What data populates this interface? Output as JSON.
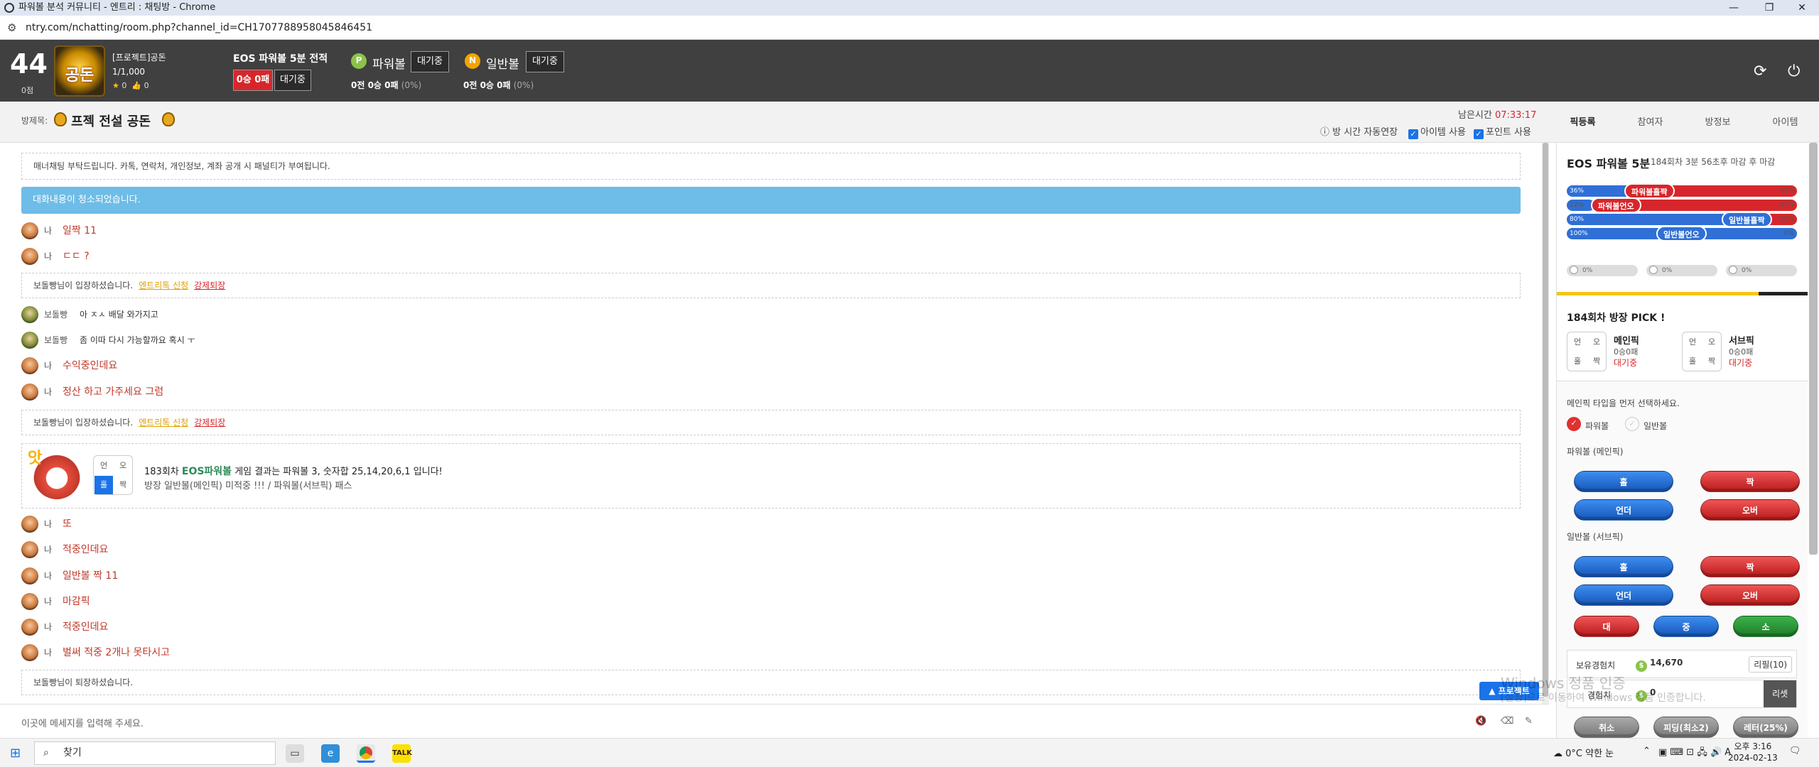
{
  "browser": {
    "title": "파워볼 분석 커뮤니티 - 엔트리 : 채팅방 - Chrome",
    "url": "ntry.com/nchatting/room.php?channel_id=CH1707788958045846451"
  },
  "header": {
    "level": "44",
    "level_sub": "0점",
    "avatar_text": "공돈",
    "username": "[프로젝트]공돈",
    "count": "1/1,000",
    "stars": "0",
    "likes": "0",
    "eos_title": "EOS 파워볼 5분 전적",
    "eos_record": "0승 0패",
    "eos_status": "대기중",
    "powerball_label": "파워볼",
    "powerball_status": "대기중",
    "powerball_record": "0전 0승 0패",
    "powerball_pct": "(0%)",
    "normalball_label": "일반볼",
    "normalball_status": "대기중",
    "normalball_record": "0전 0승 0패",
    "normalball_pct": "(0%)",
    "p_badge": "P",
    "n_badge": "N"
  },
  "room": {
    "label": "방제목:",
    "name": "프젝 전설 공돈",
    "remain_label": "남은시간",
    "remain_time": "07:33:17",
    "opt_extend": "방 시간 자동연장",
    "opt_item": "아이템 사용",
    "opt_point": "포인트 사용"
  },
  "tabs": [
    "픽등록",
    "참여자",
    "방정보",
    "아이템"
  ],
  "chat": {
    "notice": "매너채팅 부탁드립니다. 카톡, 연락처, 개인정보, 계좌 공개 시 패널티가 부여됩니다.",
    "cleared": "대화내용이 청소되었습니다.",
    "me": "나",
    "other": "보돌빵",
    "m1": "일짝 11",
    "m2": "ㄷㄷ ?",
    "join_text": "보돌빵님이 입장하셨습니다.",
    "entry_link": "엔트리톡 신청",
    "kick_link": "강제퇴장",
    "m3": "아 ㅈㅅ 배달 와가지고",
    "m4": "좀 이따 다시 가능할까요 혹시 ㅜ",
    "m5": "수익중인데요",
    "m6": "정산 하고 가주세요 그럼",
    "result_round": "183회차",
    "result_game": "EOS파워볼",
    "result_text": "게임 결과는 파워볼 3, 숫자합 25,14,20,6,1 입니다!",
    "result_host": "방장 일반볼(메인픽)",
    "result_miss": "미적중 !!! / 파워볼(서브픽) 패스",
    "grid": [
      "언",
      "오",
      "홀",
      "짝"
    ],
    "m7": "또",
    "m8": "적중인데요",
    "m9": "일반볼 짝 11",
    "m10": "마감픽",
    "m11": "적중인데요",
    "m12": "벌써 적중 2개나 못타시고",
    "leave_text": "보돌빵님이 퇴장하셨습니다.",
    "input_placeholder": "이곳에 메세지를 입력해 주세요.",
    "project_btn": "▲ 프로젝트"
  },
  "panel": {
    "game_title": "EOS 파워볼 5분",
    "game_sub": "184회차 3분 56초후 마감 후 마감",
    "bars": [
      {
        "label": "파워볼홀짝",
        "left": "36%",
        "right": "63%",
        "blue": 0.36,
        "red": 0.63
      },
      {
        "label": "파워볼언오",
        "left": "12%",
        "right": "87%",
        "blue": 0.12,
        "red": 0.87
      },
      {
        "label": "일반볼홀짝",
        "left": "80%",
        "right": "20%",
        "blue": 0.8,
        "red": 0.2
      },
      {
        "label": "일반볼언오",
        "left": "100%",
        "right": "0%",
        "blue": 1.0,
        "red": 0
      }
    ],
    "mini": [
      "0%",
      "0%",
      "0%"
    ],
    "pick_title": "184회차 방장 PICK !",
    "main_pick": "메인픽",
    "sub_pick": "서브픽",
    "pick_record": "0승0패",
    "pick_wait": "대기중",
    "grid": [
      "언",
      "오",
      "홀",
      "짝"
    ],
    "select_hint": "메인픽 타입을 먼저 선택하세요.",
    "type_power": "파워볼",
    "type_normal": "일반볼",
    "power_section": "파워볼 (메인픽)",
    "normal_section": "일반볼 (서브픽)",
    "btn_odd": "홀",
    "btn_even": "짝",
    "btn_under": "언더",
    "btn_over": "오버",
    "btn_big": "대",
    "btn_mid": "중",
    "btn_small": "소",
    "exp_label": "보유경험치",
    "exp_value": "14,670",
    "refill": "리필(10)",
    "exp2_label": "경험치",
    "exp2_value": "0",
    "reset": "리셋",
    "bottom_btns": [
      "취소",
      "피딩(최소2)",
      "레터(25%)"
    ]
  },
  "watermark": {
    "line1": "Windows 정품 인증",
    "line2": "[설정]으로 이동하여 Windows 정품 인증합니다."
  },
  "taskbar": {
    "search": "찾기",
    "weather": "0°C  약한 눈",
    "time": "오후 3:16",
    "date": "2024-02-13"
  }
}
